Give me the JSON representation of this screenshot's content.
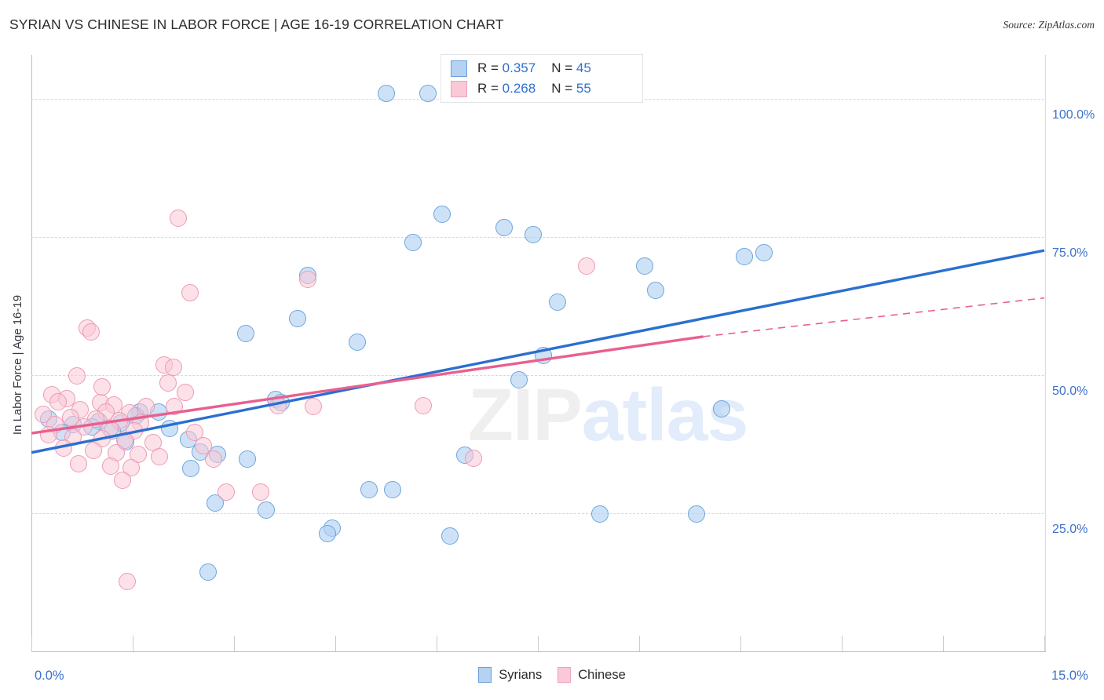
{
  "header": {
    "title": "SYRIAN VS CHINESE IN LABOR FORCE | AGE 16-19 CORRELATION CHART",
    "source": "Source: ZipAtlas.com"
  },
  "watermark": {
    "part1": "ZIP",
    "part2": "atlas"
  },
  "stats_legend": {
    "rows": [
      {
        "series": "Syrians",
        "r_label": "R = ",
        "r_value": "0.357",
        "n_label": "N = ",
        "n_value": "45",
        "color": "#b6d2f2"
      },
      {
        "series": "Chinese",
        "r_label": "R = ",
        "r_value": "0.268",
        "n_label": "N = ",
        "n_value": "55",
        "color": "#f9c9d7"
      }
    ]
  },
  "bottom_legend": {
    "items": [
      {
        "label": "Syrians",
        "color": "#b6d2f2"
      },
      {
        "label": "Chinese",
        "color": "#f9c9d7"
      }
    ]
  },
  "axes": {
    "y_title": "In Labor Force | Age 16-19",
    "y_ticks": [
      "100.0%",
      "75.0%",
      "50.0%",
      "25.0%"
    ],
    "x_min_label": "0.0%",
    "x_max_label": "15.0%"
  },
  "chart_data": {
    "type": "scatter",
    "title": "SYRIAN VS CHINESE IN LABOR FORCE | AGE 16-19 CORRELATION CHART",
    "xlabel": "",
    "ylabel": "In Labor Force | Age 16-19",
    "xlim": [
      0.0,
      15.0
    ],
    "ylim": [
      0.0,
      108.0
    ],
    "x_unit": "%",
    "y_unit": "%",
    "grid": true,
    "gridlines_y": [
      100.0,
      75.0,
      50.0,
      25.0
    ],
    "legend_position": "bottom-center",
    "series": [
      {
        "name": "Syrians",
        "color": "#b6d2f2",
        "edge_color": "#6fa4db",
        "R": 0.357,
        "N": 45,
        "trend": {
          "x0": 0.0,
          "y0": 36.0,
          "x1": 15.0,
          "y1": 72.6,
          "style": "solid",
          "color": "#2a6fd0"
        },
        "points": [
          [
            5.25,
            101.0
          ],
          [
            5.87,
            101.0
          ],
          [
            6.08,
            79.2
          ],
          [
            7.0,
            76.7
          ],
          [
            7.43,
            75.5
          ],
          [
            5.65,
            74.0
          ],
          [
            10.85,
            72.2
          ],
          [
            10.56,
            71.5
          ],
          [
            9.08,
            69.8
          ],
          [
            4.09,
            68.0
          ],
          [
            9.24,
            65.4
          ],
          [
            7.79,
            63.3
          ],
          [
            3.94,
            60.3
          ],
          [
            3.18,
            57.5
          ],
          [
            4.83,
            56.0
          ],
          [
            7.58,
            53.6
          ],
          [
            7.22,
            49.2
          ],
          [
            3.62,
            45.6
          ],
          [
            3.7,
            45.1
          ],
          [
            10.22,
            43.9
          ],
          [
            1.6,
            43.4
          ],
          [
            1.88,
            43.4
          ],
          [
            1.55,
            42.6
          ],
          [
            0.26,
            42.0
          ],
          [
            1.0,
            41.6
          ],
          [
            1.33,
            41.3
          ],
          [
            0.62,
            41.0
          ],
          [
            0.9,
            40.7
          ],
          [
            2.05,
            40.4
          ],
          [
            1.2,
            40.0
          ],
          [
            0.45,
            39.6
          ],
          [
            2.32,
            38.3
          ],
          [
            1.4,
            38.0
          ],
          [
            2.5,
            36.1
          ],
          [
            2.75,
            35.6
          ],
          [
            6.42,
            35.5
          ],
          [
            3.2,
            34.8
          ],
          [
            2.36,
            33.1
          ],
          [
            5.0,
            29.3
          ],
          [
            5.35,
            29.3
          ],
          [
            8.42,
            24.9
          ],
          [
            9.85,
            24.9
          ],
          [
            3.48,
            25.6
          ],
          [
            2.72,
            26.8
          ],
          [
            4.45,
            22.3
          ],
          [
            4.38,
            21.3
          ],
          [
            6.2,
            20.9
          ],
          [
            2.62,
            14.3
          ]
        ]
      },
      {
        "name": "Chinese",
        "color": "#f9c9d7",
        "edge_color": "#ee9ab3",
        "R": 0.268,
        "N": 55,
        "trend": {
          "x0": 0.0,
          "y0": 39.5,
          "x1": 9.95,
          "y1": 57.0,
          "style": "solid",
          "color": "#e8608f",
          "extension": {
            "x0": 9.95,
            "y0": 57.0,
            "x1": 15.0,
            "y1": 64.0,
            "style": "dashed"
          }
        },
        "points": [
          [
            2.18,
            78.5
          ],
          [
            8.22,
            69.8
          ],
          [
            4.09,
            67.4
          ],
          [
            2.35,
            64.9
          ],
          [
            0.82,
            58.5
          ],
          [
            0.88,
            57.8
          ],
          [
            1.97,
            51.9
          ],
          [
            2.1,
            51.4
          ],
          [
            0.68,
            49.9
          ],
          [
            2.02,
            48.6
          ],
          [
            2.28,
            46.9
          ],
          [
            0.3,
            46.4
          ],
          [
            0.52,
            45.8
          ],
          [
            0.4,
            45.2
          ],
          [
            1.02,
            45.0
          ],
          [
            1.22,
            44.6
          ],
          [
            1.7,
            44.4
          ],
          [
            2.12,
            44.3
          ],
          [
            3.65,
            44.5
          ],
          [
            4.18,
            44.4
          ],
          [
            5.8,
            44.5
          ],
          [
            0.72,
            43.7
          ],
          [
            1.1,
            43.4
          ],
          [
            1.45,
            43.2
          ],
          [
            0.18,
            42.9
          ],
          [
            0.58,
            42.4
          ],
          [
            0.95,
            42.0
          ],
          [
            1.3,
            41.8
          ],
          [
            1.62,
            41.4
          ],
          [
            0.35,
            41.1
          ],
          [
            0.78,
            40.6
          ],
          [
            1.16,
            40.3
          ],
          [
            1.52,
            40.0
          ],
          [
            2.42,
            39.6
          ],
          [
            0.25,
            39.2
          ],
          [
            0.62,
            38.8
          ],
          [
            1.05,
            38.5
          ],
          [
            1.38,
            38.2
          ],
          [
            1.8,
            37.8
          ],
          [
            2.55,
            37.2
          ],
          [
            0.48,
            36.8
          ],
          [
            0.92,
            36.4
          ],
          [
            1.25,
            36.0
          ],
          [
            1.58,
            35.6
          ],
          [
            1.9,
            35.2
          ],
          [
            2.7,
            34.8
          ],
          [
            6.55,
            34.9
          ],
          [
            0.7,
            34.0
          ],
          [
            1.18,
            33.6
          ],
          [
            1.48,
            33.2
          ],
          [
            2.88,
            28.8
          ],
          [
            3.4,
            28.8
          ],
          [
            1.35,
            31.0
          ],
          [
            1.42,
            12.6
          ],
          [
            1.05,
            47.9
          ]
        ]
      }
    ]
  }
}
